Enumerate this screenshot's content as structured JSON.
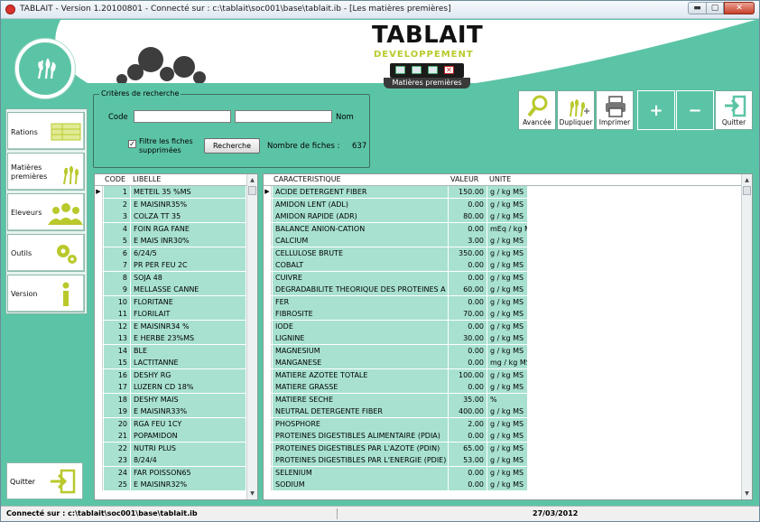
{
  "window": {
    "title": "TABLAIT - Version 1.20100801 - Connecté sur : c:\\tablait\\soc001\\base\\tablait.ib - [Les matières premières]",
    "min_label": "▬",
    "max_label": "▢",
    "close_label": "✕"
  },
  "brand": {
    "name": "TABLAIT",
    "subtitle": "DEVELOPPEMENT",
    "module_label": "Matières premières"
  },
  "colors": {
    "accent": "#5cc4a6",
    "row": "#a8e1d0",
    "lime": "#b9c92c"
  },
  "nav": {
    "rations": "Rations",
    "matieres_l1": "Matières",
    "matieres_l2": "premières",
    "eleveurs": "Eleveurs",
    "outils": "Outils",
    "version": "Version",
    "quitter": "Quitter"
  },
  "search": {
    "legend": "Critères de recherche",
    "code_label": "Code",
    "code_value": "",
    "nom_label": "Nom",
    "nom_value": "",
    "filter_checked": "✓",
    "filter_label_l1": "Filtre les fiches",
    "filter_label_l2": "supprimées",
    "search_button": "Recherche",
    "count_label": "Nombre de fiches :",
    "count_value": "637"
  },
  "toolbar": {
    "avancee": "Avancée",
    "dupliquer": "Dupliquer",
    "imprimer": "Imprimer",
    "plus": "+",
    "minus": "−",
    "quitter": "Quitter"
  },
  "left_grid": {
    "columns": [
      "CODE",
      "LIBELLE"
    ],
    "rows": [
      [
        "1",
        "METEIL 35 %MS"
      ],
      [
        "2",
        "E MAISINR35%"
      ],
      [
        "3",
        "COLZA TT 35"
      ],
      [
        "4",
        "FOIN RGA FANE"
      ],
      [
        "5",
        "E MAIS INR30%"
      ],
      [
        "6",
        "6/24/5"
      ],
      [
        "7",
        "PR PER FEU 2C"
      ],
      [
        "8",
        "SOJA 48"
      ],
      [
        "9",
        "MELLASSE CANNE"
      ],
      [
        "10",
        "FLORITANE"
      ],
      [
        "11",
        "FLORILAIT"
      ],
      [
        "12",
        "E MAISINR34 %"
      ],
      [
        "13",
        "E HERBE 23%MS"
      ],
      [
        "14",
        "BLE"
      ],
      [
        "15",
        "LACTITANNE"
      ],
      [
        "16",
        "DESHY RG"
      ],
      [
        "17",
        "LUZERN CD 18%"
      ],
      [
        "18",
        "DESHY MAIS"
      ],
      [
        "19",
        "E MAISINR33%"
      ],
      [
        "20",
        "RGA FEU 1CY"
      ],
      [
        "21",
        "POPAMIDON"
      ],
      [
        "22",
        "NUTRI PLUS"
      ],
      [
        "23",
        "8/24/4"
      ],
      [
        "24",
        "FAR POISSON65"
      ],
      [
        "25",
        "E MAISINR32%"
      ]
    ]
  },
  "right_grid": {
    "columns": [
      "CARACTERISTIQUE",
      "VALEUR",
      "UNITE"
    ],
    "rows": [
      [
        "ACIDE DETERGENT FIBER",
        "150.00",
        "g / kg MS"
      ],
      [
        "AMIDON LENT (ADL)",
        "0.00",
        "g / kg MS"
      ],
      [
        "AMIDON RAPIDE (ADR)",
        "80.00",
        "g / kg MS"
      ],
      [
        "BALANCE ANION-CATION",
        "0.00",
        "mEq / kg M"
      ],
      [
        "CALCIUM",
        "3.00",
        "g / kg MS"
      ],
      [
        "CELLULOSE BRUTE",
        "350.00",
        "g / kg MS"
      ],
      [
        "COBALT",
        "0.00",
        "g / kg MS"
      ],
      [
        "CUIVRE",
        "0.00",
        "g / kg MS"
      ],
      [
        "DEGRADABILITE THEORIQUE DES PROTEINES A",
        "60.00",
        "g / kg MS"
      ],
      [
        "FER",
        "0.00",
        "g / kg MS"
      ],
      [
        "FIBROSITE",
        "70.00",
        "g / kg MS"
      ],
      [
        "IODE",
        "0.00",
        "g / kg MS"
      ],
      [
        "LIGNINE",
        "30.00",
        "g / kg MS"
      ],
      [
        "MAGNESIUM",
        "0.00",
        "g / kg MS"
      ],
      [
        "MANGANESE",
        "0.00",
        "mg / kg MS"
      ],
      [
        "MATIERE AZOTEE TOTALE",
        "100.00",
        "g / kg MS"
      ],
      [
        "MATIERE GRASSE",
        "0.00",
        "g / kg MS"
      ],
      [
        "MATIERE SECHE",
        "35.00",
        "%"
      ],
      [
        "NEUTRAL DETERGENTE FIBER",
        "400.00",
        "g / kg MS"
      ],
      [
        "PHOSPHORE",
        "2.00",
        "g / kg MS"
      ],
      [
        "PROTEINES DIGESTIBLES ALIMENTAIRE (PDIA)",
        "0.00",
        "g / kg MS"
      ],
      [
        "PROTEINES DIGESTIBLES PAR L'AZOTE (PDIN)",
        "65.00",
        "g / kg MS"
      ],
      [
        "PROTEINES DIGESTIBLES PAR L'ENERGIE (PDIE)",
        "53.00",
        "g / kg MS"
      ],
      [
        "SELENIUM",
        "0.00",
        "g / kg MS"
      ],
      [
        "SODIUM",
        "0.00",
        "g / kg MS"
      ]
    ]
  },
  "status": {
    "connection": "Connecté sur : c:\\tablait\\soc001\\base\\tablait.ib",
    "date": "27/03/2012"
  }
}
